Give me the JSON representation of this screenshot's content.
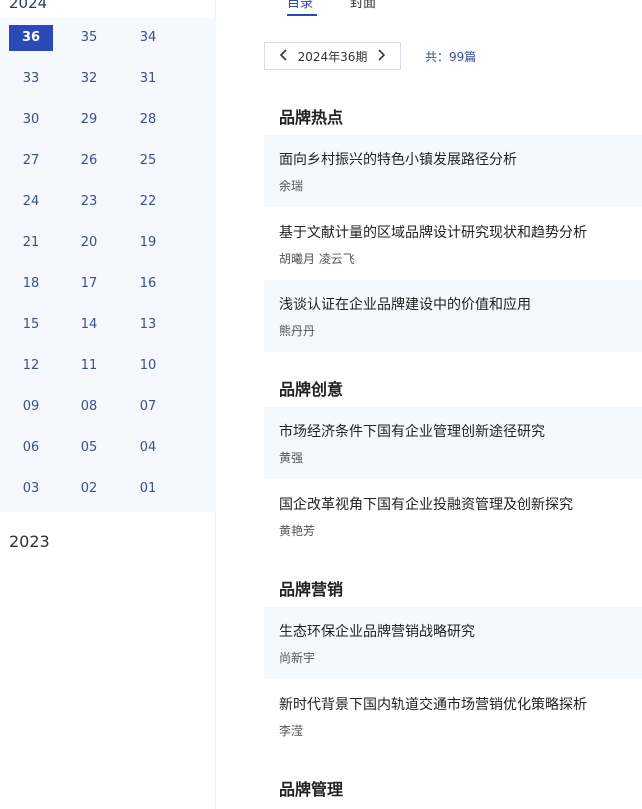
{
  "sidebar": {
    "year_current": "2024",
    "year_prev": "2023",
    "issues": [
      "36",
      "35",
      "34",
      "33",
      "32",
      "31",
      "30",
      "29",
      "28",
      "27",
      "26",
      "25",
      "24",
      "23",
      "22",
      "21",
      "20",
      "19",
      "18",
      "17",
      "16",
      "15",
      "14",
      "13",
      "12",
      "11",
      "10",
      "09",
      "08",
      "07",
      "06",
      "05",
      "04",
      "03",
      "02",
      "01"
    ],
    "active_issue": "36"
  },
  "tabs": {
    "first": "目录",
    "second": "封面"
  },
  "issue_nav": {
    "label": "2024年36期",
    "prev_icon": "chevron-left-icon",
    "next_icon": "chevron-right-icon",
    "total": "共：99篇"
  },
  "sections": [
    {
      "title": "品牌热点",
      "articles": [
        {
          "title": "面向乡村振兴的特色小镇发展路径分析",
          "author": "余瑞"
        },
        {
          "title": "基于文献计量的区域品牌设计研究现状和趋势分析",
          "author": "胡曦月  凌云飞"
        },
        {
          "title": "浅谈认证在企业品牌建设中的价值和应用",
          "author": "熊丹丹"
        }
      ]
    },
    {
      "title": "品牌创意",
      "articles": [
        {
          "title": "市场经济条件下国有企业管理创新途径研究",
          "author": "黄强"
        },
        {
          "title": "国企改革视角下国有企业投融资管理及创新探究",
          "author": "黄艳芳"
        }
      ]
    },
    {
      "title": "品牌营销",
      "articles": [
        {
          "title": "生态环保企业品牌营销战略研究",
          "author": "尚新宇"
        },
        {
          "title": "新时代背景下国内轨道交通市场营销优化策略探析",
          "author": "李滢"
        }
      ]
    },
    {
      "title": "品牌管理",
      "articles": []
    }
  ],
  "colors": {
    "accent": "#2a4ab8",
    "shade": "#f5f8fc"
  }
}
